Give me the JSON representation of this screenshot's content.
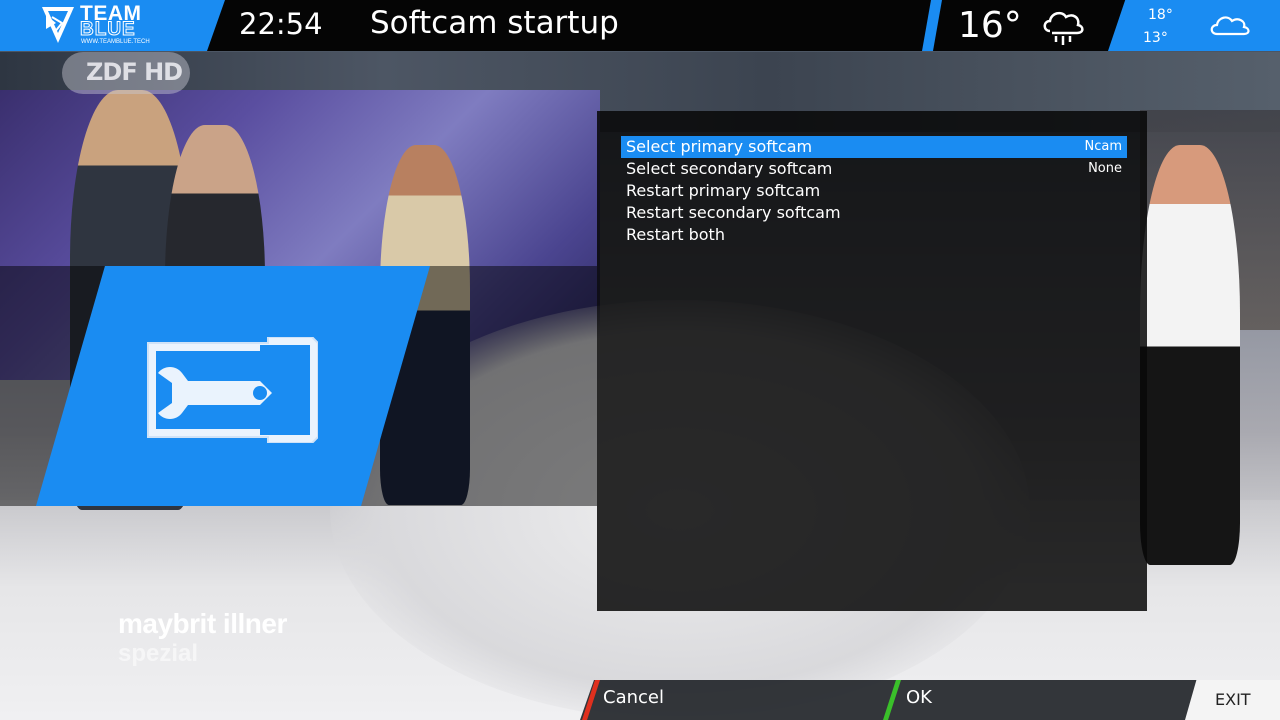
{
  "header": {
    "logo": {
      "line1": "TEAM",
      "line2": "BLUE",
      "url": "WWW.TEAMBLUE.TECH"
    },
    "clock": "22:54",
    "title": "Softcam startup"
  },
  "weather": {
    "current_temp": "16°",
    "current_icon": "rain-cloud-icon",
    "forecast_high": "18°",
    "forecast_low": "13°",
    "forecast_icon": "cloud-icon"
  },
  "background": {
    "channel_logo": "ZDF HD",
    "show_title": "maybrit illner",
    "show_subtitle": "spezial"
  },
  "plugin_icon": "softcam-card-wrench-icon",
  "menu": {
    "items": [
      {
        "label": "Select primary softcam",
        "value": "Ncam",
        "selected": true
      },
      {
        "label": "Select secondary softcam",
        "value": "None",
        "selected": false
      },
      {
        "label": "Restart primary softcam",
        "value": "",
        "selected": false
      },
      {
        "label": "Restart secondary softcam",
        "value": "",
        "selected": false
      },
      {
        "label": "Restart both",
        "value": "",
        "selected": false
      }
    ]
  },
  "buttons": {
    "red": "Cancel",
    "green": "OK",
    "exit": "EXIT"
  },
  "colors": {
    "accent": "#1a8cf2",
    "red_key": "#e0301e",
    "green_key": "#3ac02a"
  }
}
